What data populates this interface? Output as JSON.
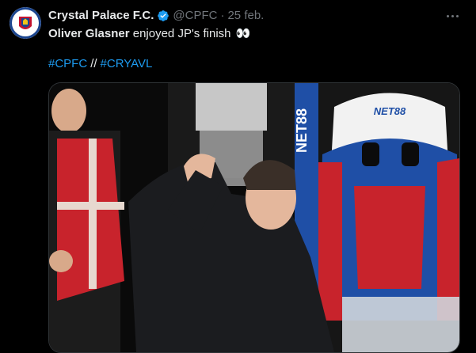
{
  "tweet": {
    "account_name": "Crystal Palace F.C.",
    "handle": "@CPFC",
    "separator": "·",
    "date": "25 feb.",
    "text_bold": "Oliver Glasner",
    "text_rest": " enjoyed JP's finish",
    "text_emoji": "👀",
    "hashtags": [
      "#CPFC",
      "#CRYAVL"
    ],
    "hashtag_separator": "//"
  },
  "media": {
    "board_text": "NET88",
    "seat_text": "NET88"
  },
  "colors": {
    "background": "#000000",
    "text": "#e7e9ea",
    "muted": "#71767b",
    "link": "#1d9bf0",
    "verified": "#1d9bf0",
    "seat_blue": "#1f4fa6",
    "seat_red": "#c8232c"
  },
  "icons": {
    "avatar": "crystal-palace-crest",
    "verified": "verified-badge-icon",
    "more": "more-options-icon"
  }
}
